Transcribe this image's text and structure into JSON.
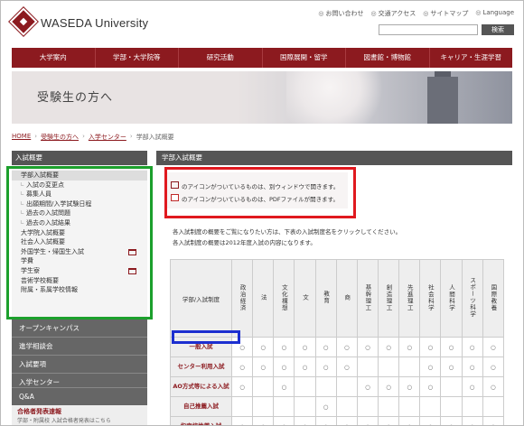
{
  "header": {
    "logo_text": "WASEDA University",
    "top_links": [
      "お問い合わせ",
      "交通アクセス",
      "サイトマップ",
      "Language"
    ],
    "search_button": "検索"
  },
  "nav": {
    "items": [
      "大学案内",
      "学部・大学院等",
      "研究活動",
      "国際展開・留学",
      "図書館・博物館",
      "キャリア・生涯学習"
    ]
  },
  "banner": {
    "title": "受験生の方へ"
  },
  "breadcrumb": {
    "items": [
      "HOME",
      "受験生の方へ",
      "入学センター",
      "学部入試概要"
    ],
    "separator": "›"
  },
  "sidebar": {
    "title": "入試概要",
    "items": [
      {
        "label": "学部入試概要",
        "sub": false,
        "active": true,
        "window_icon": false
      },
      {
        "label": "入試の変更点",
        "sub": true,
        "active": false,
        "window_icon": false
      },
      {
        "label": "募集人員",
        "sub": true,
        "active": false,
        "window_icon": false
      },
      {
        "label": "出願期間/入学試験日程",
        "sub": true,
        "active": false,
        "window_icon": false
      },
      {
        "label": "過去の入試問題",
        "sub": true,
        "active": false,
        "window_icon": false
      },
      {
        "label": "過去の入試結果",
        "sub": true,
        "active": false,
        "window_icon": false
      },
      {
        "label": "大学院入試概要",
        "sub": false,
        "active": false,
        "window_icon": false
      },
      {
        "label": "社会人入試概要",
        "sub": false,
        "active": false,
        "window_icon": false
      },
      {
        "label": "外国学生・帰国生入試",
        "sub": false,
        "active": false,
        "window_icon": true
      },
      {
        "label": "学費",
        "sub": false,
        "active": false,
        "window_icon": false
      },
      {
        "label": "学生寮",
        "sub": false,
        "active": false,
        "window_icon": true
      },
      {
        "label": "芸術学校概要",
        "sub": false,
        "active": false,
        "window_icon": false
      },
      {
        "label": "附属・系属学校情報",
        "sub": false,
        "active": false,
        "window_icon": false
      }
    ],
    "sections": [
      "オープンキャンパス",
      "進学相談会",
      "入試要項",
      "入学センター",
      "Q&A"
    ],
    "footer_title": "合格者発表速報",
    "footer_sub": "学部・附属校 入試合格者発表はこちら"
  },
  "main": {
    "title": "学部入試概要",
    "notice_window": "のアイコンがついているものは、別ウィンドウで開きます。",
    "notice_pdf": "のアイコンがついているものは、PDFファイルが開きます。",
    "desc1": "各入試制度の概要をご覧になりたい方は、下表の入試制度名をクリックしてください。",
    "desc2": "各入試制度の概要は2012年度入試の内容になります。",
    "table": {
      "corner": "学部/入試制度",
      "columns": [
        "政治経済",
        "法",
        "文化構想",
        "文",
        "教育",
        "商",
        "基幹理工",
        "創造理工",
        "先進理工",
        "社会科学",
        "人間科学",
        "スポーツ科学",
        "国際教養"
      ],
      "rows": [
        {
          "label": "一般入試",
          "cells": [
            "○",
            "○",
            "○",
            "○",
            "○",
            "○",
            "○",
            "○",
            "○",
            "○",
            "○",
            "○",
            "○"
          ]
        },
        {
          "label": "センター利用入試",
          "cells": [
            "○",
            "○",
            "○",
            "○",
            "○",
            "○",
            "",
            "",
            "",
            "○",
            "○",
            "○",
            "○"
          ]
        },
        {
          "label": "AO方式等による入試",
          "cells": [
            "○",
            "",
            "○",
            "",
            "",
            "",
            "○",
            "○",
            "○",
            "○",
            "",
            "○",
            "○"
          ]
        },
        {
          "label": "自己推薦入試",
          "cells": [
            "",
            "",
            "",
            "",
            "○",
            "",
            "",
            "",
            "",
            "",
            "",
            "",
            ""
          ]
        },
        {
          "label": "指定校推薦入試",
          "cells": [
            "○",
            "○",
            "○",
            "○",
            "○",
            "○",
            "○",
            "○",
            "○",
            "○",
            "○",
            "○",
            "○"
          ]
        }
      ]
    }
  }
}
